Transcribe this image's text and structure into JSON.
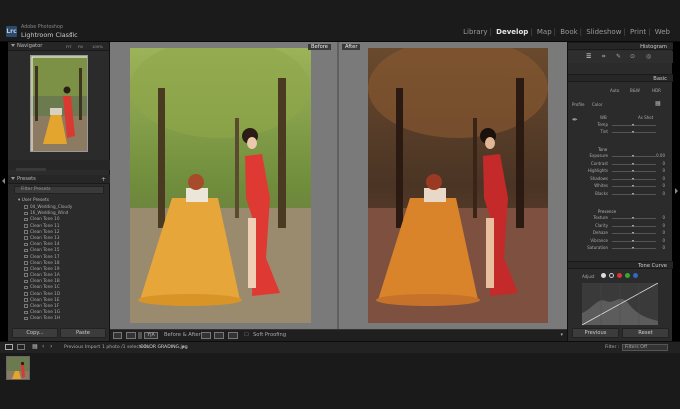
{
  "app": {
    "vendor": "Adobe Photoshop",
    "name": "Lightroom Classic",
    "logo": "Lrc"
  },
  "modules": [
    "Library",
    "Develop",
    "Map",
    "Book",
    "Slideshow",
    "Print",
    "Web"
  ],
  "active_module": "Develop",
  "left": {
    "navigator_title": "Navigator",
    "nav_options": [
      "FIT",
      "Fill",
      "100%"
    ],
    "presets_title": "Presets",
    "filter_label": "Filter Presets",
    "group": "User Presets",
    "items": [
      "04_Wedding_Cloudy",
      "16_Wedding_Wind",
      "Clean Tone 10",
      "Clean Tone 11",
      "Clean Tone 12",
      "Clean Tone 13",
      "Clean Tone 14",
      "Clean Tone 15",
      "Clean Tone 17",
      "Clean Tone 18",
      "Clean Tone 19",
      "Clean Tone 1A",
      "Clean Tone 1B",
      "Clean Tone 1C",
      "Clean Tone 1D",
      "Clean Tone 1E",
      "Clean Tone 1F",
      "Clean Tone 1G",
      "Clean Tone 1H"
    ],
    "copy_btn": "Copy...",
    "paste_btn": "Paste"
  },
  "center": {
    "before_label": "Before",
    "after_label": "After"
  },
  "toolbar": {
    "mode_label": "Before & After",
    "ya_label": "Y|A",
    "soft_proofing": "Soft Proofing"
  },
  "right": {
    "histogram_title": "Histogram",
    "basic_title": "Basic",
    "treatment": [
      "Auto",
      "B&W",
      "HDR"
    ],
    "profile_label": "Profile",
    "profile_value": "Color",
    "wb_label": "WB",
    "wb_value": "As Shot",
    "tone_label": "Tone",
    "presence_label": "Presence",
    "sliders_top": [
      {
        "name": "Temp",
        "value": ""
      },
      {
        "name": "Tint",
        "value": ""
      }
    ],
    "sliders_tone": [
      {
        "name": "Exposure",
        "value": "0.00"
      },
      {
        "name": "Contrast",
        "value": "0"
      },
      {
        "name": "Highlights",
        "value": "0"
      },
      {
        "name": "Shadows",
        "value": "0"
      },
      {
        "name": "Whites",
        "value": "0"
      },
      {
        "name": "Blacks",
        "value": "0"
      }
    ],
    "sliders_presence": [
      {
        "name": "Texture",
        "value": "0"
      },
      {
        "name": "Clarity",
        "value": "0"
      },
      {
        "name": "Dehaze",
        "value": "0"
      },
      {
        "name": "Vibrance",
        "value": "0"
      },
      {
        "name": "Saturation",
        "value": "0"
      }
    ],
    "tone_curve_title": "Tone Curve",
    "adjust_label": "Adjust",
    "previous_btn": "Previous",
    "reset_btn": "Reset"
  },
  "filmbar": {
    "source": "Previous Import",
    "info": "1 photo /1 selected /",
    "filename": "COLOR GRADING.jpg",
    "filter_label": "Filter :",
    "filter_value": "Filters Off"
  }
}
